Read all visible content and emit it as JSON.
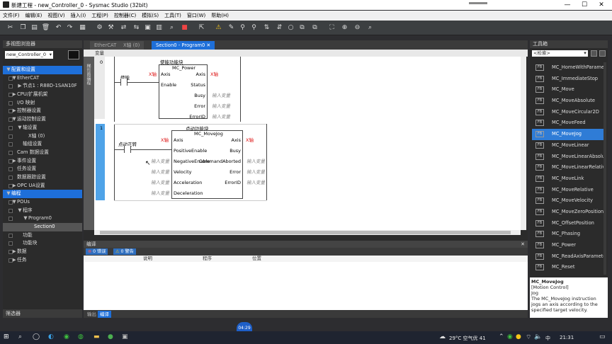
{
  "window": {
    "title": "新建工程 - new_Controller_0 - Sysmac Studio (32bit)"
  },
  "menu": [
    "文件(F)",
    "编辑(E)",
    "视图(V)",
    "插入(I)",
    "工程(P)",
    "控制器(C)",
    "模拟(S)",
    "工具(T)",
    "窗口(W)",
    "帮助(H)"
  ],
  "left_pane": {
    "title": "多视图浏览器",
    "controller": "new_Controller_0",
    "tree": [
      {
        "label": "配置和设置",
        "level": 0,
        "arrow": "▼",
        "style": "hl"
      },
      {
        "label": "EtherCAT",
        "level": 1,
        "arrow": "▼"
      },
      {
        "label": "节点1 : R88D-1SAN10F",
        "level": 2,
        "arrow": "▶"
      },
      {
        "label": "CPU/扩展机架",
        "level": 1,
        "arrow": "▶"
      },
      {
        "label": "I/O 映射",
        "level": 1,
        "arrow": ""
      },
      {
        "label": "控制器设置",
        "level": 1,
        "arrow": "▶"
      },
      {
        "label": "运动控制设置",
        "level": 1,
        "arrow": "▼"
      },
      {
        "label": "轴设置",
        "level": 2,
        "arrow": "▼"
      },
      {
        "label": "X轴 (0)",
        "level": 3,
        "arrow": ""
      },
      {
        "label": "轴组设置",
        "level": 2,
        "arrow": ""
      },
      {
        "label": "Cam 数据设置",
        "level": 1,
        "arrow": ""
      },
      {
        "label": "事件设置",
        "level": 1,
        "arrow": "▶"
      },
      {
        "label": "任务设置",
        "level": 1,
        "arrow": ""
      },
      {
        "label": "数据跟踪设置",
        "level": 1,
        "arrow": ""
      },
      {
        "label": "OPC UA设置",
        "level": 1,
        "arrow": "▶"
      },
      {
        "label": "编程",
        "level": 0,
        "arrow": "▼",
        "style": "hl"
      },
      {
        "label": "POUs",
        "level": 1,
        "arrow": "▼"
      },
      {
        "label": "程序",
        "level": 2,
        "arrow": "▼"
      },
      {
        "label": "Program0",
        "level": 3,
        "arrow": "▼"
      },
      {
        "label": "Section0",
        "level": 4,
        "arrow": "",
        "style": "sec"
      },
      {
        "label": "功能",
        "level": 2,
        "arrow": ""
      },
      {
        "label": "功能块",
        "level": 2,
        "arrow": ""
      },
      {
        "label": "数据",
        "level": 1,
        "arrow": "▶"
      },
      {
        "label": "任务",
        "level": 1,
        "arrow": "▶"
      }
    ],
    "filter_label": "筛选器"
  },
  "tabs": [
    {
      "label": "EtherCAT",
      "active": false
    },
    {
      "label": "X轴 (0)",
      "active": false
    },
    {
      "label": "Section0 - Program0",
      "active": true
    }
  ],
  "editor": {
    "var_label": "变量",
    "gutter_label": "梯形图编程",
    "rungs": [
      {
        "number": "0",
        "block_title": "使能功能块",
        "instance_name": "MC_Power",
        "contact_label": "使能",
        "inputs": [
          {
            "var": "X轴",
            "pin": "Axis",
            "red": true
          },
          {
            "var": "",
            "pin": "Enable"
          }
        ],
        "outputs": [
          {
            "pin": "Axis",
            "var": "X轴",
            "red": true
          },
          {
            "pin": "Status",
            "var": ""
          },
          {
            "pin": "Busy",
            "var": "输入变量"
          },
          {
            "pin": "Error",
            "var": "输入变量"
          },
          {
            "pin": "ErrorID",
            "var": "输入变量"
          }
        ]
      },
      {
        "number": "1",
        "block_title": "点动功能块",
        "instance_name": "MC_MoveJog",
        "contact_label": "点动正转",
        "inputs": [
          {
            "var": "X轴",
            "pin": "Axis",
            "red": true
          },
          {
            "var": "",
            "pin": "PositiveEnable"
          },
          {
            "var": "输入变量",
            "pin": "NegativeEnable"
          },
          {
            "var": "输入变量",
            "pin": "Velocity"
          },
          {
            "var": "输入变量",
            "pin": "Acceleration"
          },
          {
            "var": "输入变量",
            "pin": "Deceleration"
          }
        ],
        "outputs": [
          {
            "pin": "Axis",
            "var": "X轴",
            "red": true
          },
          {
            "pin": "Busy",
            "var": "输入变量"
          },
          {
            "pin": "CommandAborted",
            "var": "输入变量"
          },
          {
            "pin": "Error",
            "var": "输入变量"
          },
          {
            "pin": "ErrorID",
            "var": "输入变量"
          }
        ]
      }
    ]
  },
  "bottom_pane": {
    "title": "编译",
    "error_badge": "0 错误",
    "warning_badge": "0 警告",
    "columns": [
      "说明",
      "程序",
      "位置"
    ],
    "tabs": [
      {
        "label": "输出",
        "active": false
      },
      {
        "label": "编译",
        "active": true
      }
    ]
  },
  "toolbox": {
    "title": "工具箱",
    "search_placeholder": "<检索>",
    "items": [
      "MC_HomeWithParameter",
      "MC_ImmediateStop",
      "MC_Move",
      "MC_MoveAbsolute",
      "MC_MoveCircular2D",
      "MC_MoveFeed",
      "MC_MoveJog",
      "MC_MoveLinear",
      "MC_MoveLinearAbsolute",
      "MC_MoveLinearRelative",
      "MC_MoveLink",
      "MC_MoveRelative",
      "MC_MoveVelocity",
      "MC_MoveZeroPosition",
      "MC_OffsetPosition",
      "MC_Phasing",
      "MC_Power",
      "MC_ReadAxisParameter",
      "MC_Reset"
    ],
    "selected": "MC_MoveJog",
    "fb_label": "FB",
    "description": {
      "title": "MC_MoveJog",
      "category": "[Motion Control]",
      "name": "Jog",
      "text": "The MC_MoveJog instruction jogs an axis according to the specified target velocity."
    }
  },
  "taskbar": {
    "bubble": "04:29",
    "weather": "29°C 空气优 41",
    "input_method": "中",
    "clock": "21:31"
  }
}
